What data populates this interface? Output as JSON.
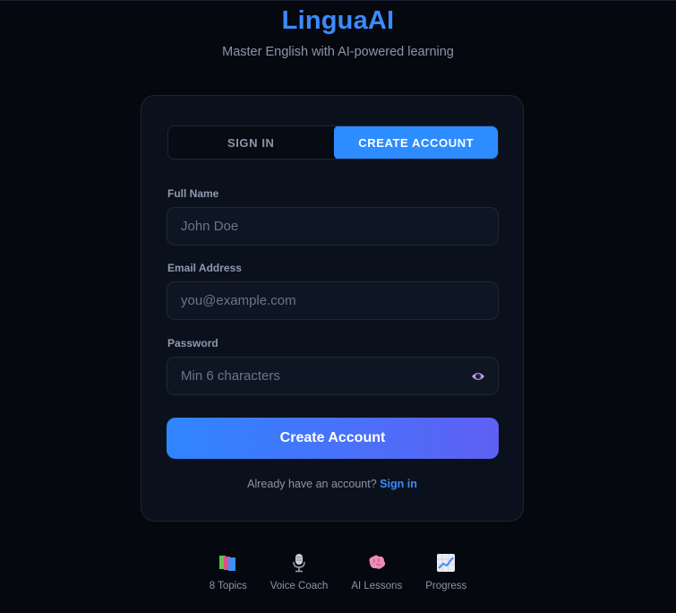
{
  "brand": {
    "title": "LinguaAI",
    "subtitle": "Master English with AI-powered learning"
  },
  "tabs": [
    {
      "label": "SIGN IN",
      "active": false
    },
    {
      "label": "CREATE ACCOUNT",
      "active": true
    }
  ],
  "form": {
    "full_name": {
      "label": "Full Name",
      "placeholder": "John Doe",
      "value": ""
    },
    "email": {
      "label": "Email Address",
      "placeholder": "you@example.com",
      "value": ""
    },
    "password": {
      "label": "Password",
      "placeholder": "Min 6 characters",
      "value": ""
    },
    "submit_label": "Create Account"
  },
  "switch": {
    "prompt": "Already have an account?",
    "link_label": "Sign in"
  },
  "features": [
    {
      "icon": "books-icon",
      "label": "8 Topics"
    },
    {
      "icon": "microphone-icon",
      "label": "Voice Coach"
    },
    {
      "icon": "brain-icon",
      "label": "AI Lessons"
    },
    {
      "icon": "chart-increasing-icon",
      "label": "Progress"
    }
  ],
  "colors": {
    "background": "#05080f",
    "card": "#0b111c",
    "accent": "#2d8cff",
    "gradient_end": "#5e60f4",
    "muted_text": "#8b95a8"
  }
}
